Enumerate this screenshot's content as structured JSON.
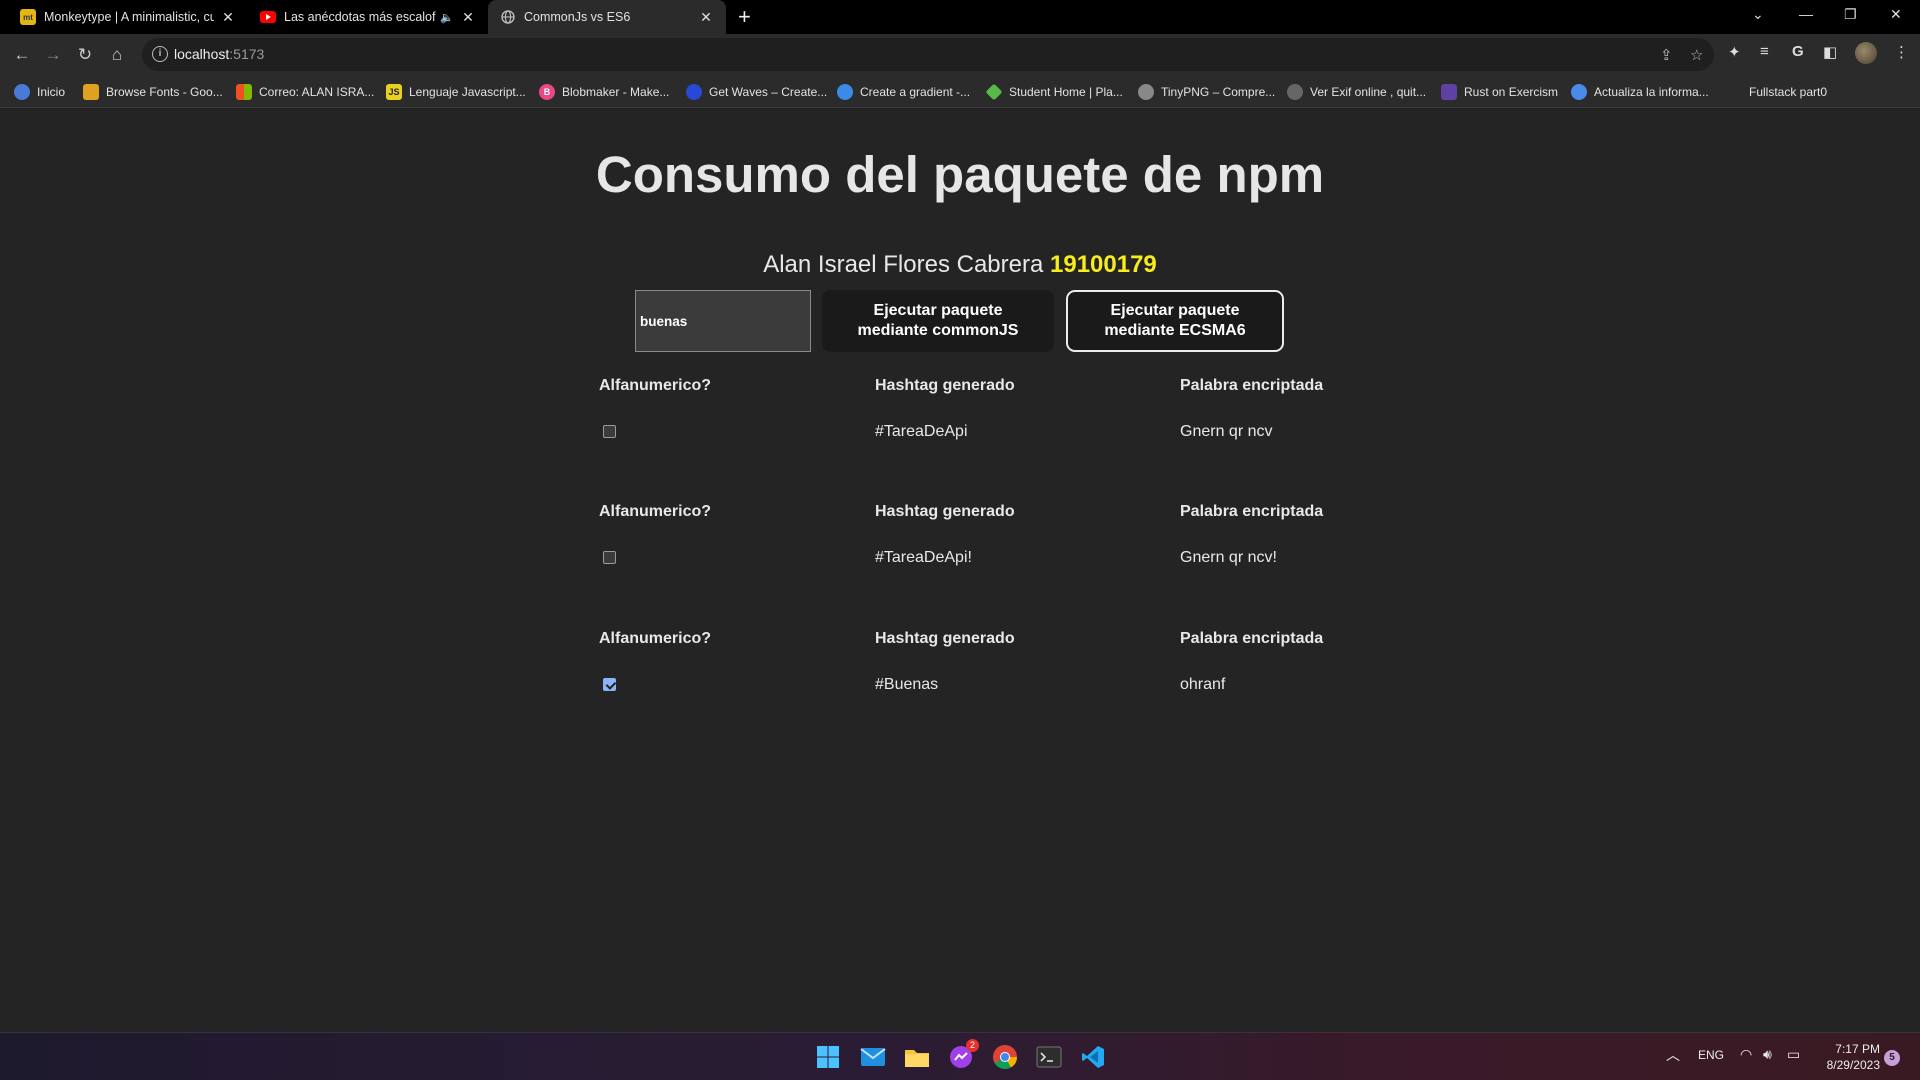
{
  "browser": {
    "tabs": [
      {
        "title": "Monkeytype | A minimalistic, cus",
        "favicon": "monkeytype-icon",
        "active": false
      },
      {
        "title": "Las anécdotas más escalofria",
        "favicon": "youtube-icon",
        "active": false,
        "muted_indicator": "🔈"
      },
      {
        "title": "CommonJs vs ES6",
        "favicon": "globe-icon",
        "active": true
      }
    ],
    "new_tab": "+",
    "close_glyph": "✕",
    "address": {
      "host": "localhost",
      "port": ":5173"
    },
    "bookmarks": [
      {
        "label": "Inicio",
        "color": "#4a7ad8"
      },
      {
        "label": "Browse Fonts - Goo...",
        "color": "#e0a020"
      },
      {
        "label": "Correo: ALAN ISRA...",
        "color": "#3a8ad8"
      },
      {
        "label": "Lenguaje Javascript...",
        "color": "#e8d020"
      },
      {
        "label": "Blobmaker - Make...",
        "color": "#e84888"
      },
      {
        "label": "Get Waves – Create...",
        "color": "#2848d8"
      },
      {
        "label": "Create a gradient -...",
        "color": "#3a8ae8"
      },
      {
        "label": "Student Home | Pla...",
        "color": "#58b848"
      },
      {
        "label": "TinyPNG – Compre...",
        "color": "#888888"
      },
      {
        "label": "Ver Exif online , quit...",
        "color": "#777777"
      },
      {
        "label": "Rust on Exercism",
        "color": "#6040a0"
      },
      {
        "label": "Actualiza la informa...",
        "color": "#4a8ae8"
      },
      {
        "label": "Fullstack part0",
        "color": "#2b2b2b"
      }
    ]
  },
  "app": {
    "title": "Consumo del paquete de npm",
    "author_name": "Alan Israel Flores Cabrera",
    "student_id": "19100179",
    "input_value": "buenas",
    "btn_commonjs_line1": "Ejecutar paquete",
    "btn_commonjs_line2": "mediante commonJS",
    "btn_es6_line1": "Ejecutar paquete",
    "btn_es6_line2": "mediante ECSMA6",
    "headers": {
      "alnum": "Alfanumerico?",
      "hashtag": "Hashtag generado",
      "encrypted": "Palabra encriptada"
    },
    "results": [
      {
        "alphanumeric": false,
        "hashtag": "#TareaDeApi",
        "encrypted": "Gnern qr ncv"
      },
      {
        "alphanumeric": false,
        "hashtag": "#TareaDeApi!",
        "encrypted": "Gnern qr ncv!"
      },
      {
        "alphanumeric": true,
        "hashtag": "#Buenas",
        "encrypted": "ohranf"
      }
    ]
  },
  "taskbar": {
    "language": "ENG",
    "time": "7:17 PM",
    "date": "8/29/2023",
    "notification_count": "5",
    "messenger_badge": "2"
  }
}
